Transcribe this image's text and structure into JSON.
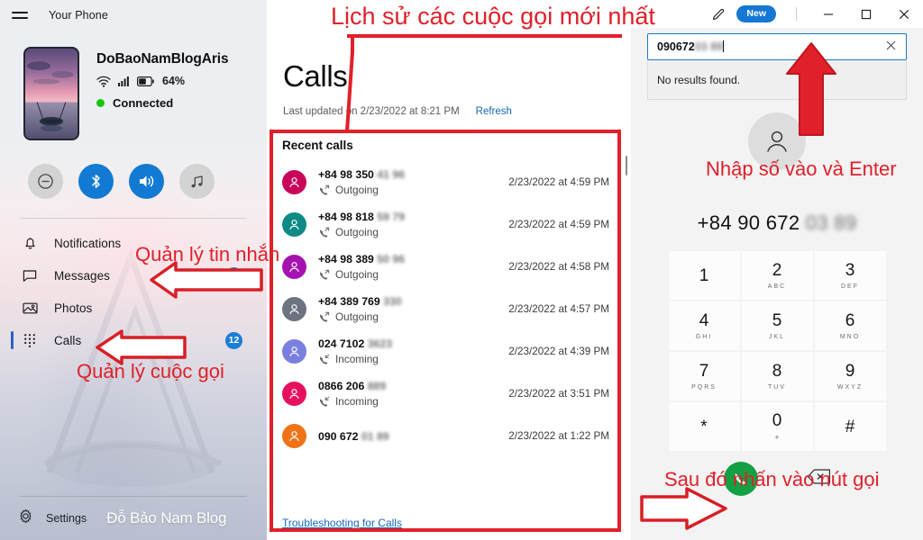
{
  "window": {
    "app_title": "Your Phone",
    "menu_icon": "hamburger-icon",
    "pen_icon": "pen-compose-icon",
    "new_badge": "New",
    "minimize": "–",
    "maximize": "□",
    "close": "✕"
  },
  "sidebar": {
    "device": {
      "name": "DoBaoNamBlogAris",
      "battery": "64%",
      "status": "Connected",
      "wifi_icon": "wifi-icon",
      "signal_icon": "cellular-signal-icon",
      "battery_icon": "battery-icon"
    },
    "quick_actions": [
      {
        "name": "do-not-disturb",
        "icon": "do-not-disturb-icon",
        "active": false
      },
      {
        "name": "bluetooth",
        "icon": "bluetooth-icon",
        "active": true
      },
      {
        "name": "volume",
        "icon": "volume-icon",
        "active": true
      },
      {
        "name": "music",
        "icon": "music-note-icon",
        "active": false
      }
    ],
    "nav_items": [
      {
        "label": "Notifications",
        "icon": "bell-icon",
        "badge": "",
        "active": false
      },
      {
        "label": "Messages",
        "icon": "message-bubble-icon",
        "badge": "30",
        "active": false
      },
      {
        "label": "Photos",
        "icon": "photo-icon",
        "badge": "",
        "active": false
      },
      {
        "label": "Calls",
        "icon": "dialpad-icon",
        "badge": "12",
        "active": true
      }
    ],
    "settings_label": "Settings",
    "settings_icon": "gear-icon",
    "watermark": "Đỗ Bảo Nam Blog"
  },
  "calls_panel": {
    "title": "Calls",
    "last_updated": "Last updated on 2/23/2022 at 8:21 PM",
    "refresh_label": "Refresh",
    "recent_header": "Recent calls",
    "troubleshoot_link": "Troubleshooting for Calls",
    "rows": [
      {
        "number_visible": "+84 98 350",
        "number_blur": "41 96",
        "direction": "Outgoing",
        "time": "2/23/2022 at 4:59 PM",
        "avatar_color": "#c9055a"
      },
      {
        "number_visible": "+84 98 818",
        "number_blur": "59 79",
        "direction": "Outgoing",
        "time": "2/23/2022 at 4:59 PM",
        "avatar_color": "#0e8a86"
      },
      {
        "number_visible": "+84 98 389",
        "number_blur": "50 96",
        "direction": "Outgoing",
        "time": "2/23/2022 at 4:58 PM",
        "avatar_color": "#a512b0"
      },
      {
        "number_visible": "+84 389 769",
        "number_blur": "330",
        "direction": "Outgoing",
        "time": "2/23/2022 at 4:57 PM",
        "avatar_color": "#6b7280"
      },
      {
        "number_visible": "024 7102",
        "number_blur": "3623",
        "direction": "Incoming",
        "time": "2/23/2022 at 4:39 PM",
        "avatar_color": "#7b7fe0"
      },
      {
        "number_visible": "0866 206",
        "number_blur": "889",
        "direction": "Incoming",
        "time": "2/23/2022 at 3:51 PM",
        "avatar_color": "#e6115e"
      },
      {
        "number_visible": "090 672",
        "number_blur": "01 89",
        "direction": "",
        "time": "2/23/2022 at 1:22 PM",
        "avatar_color": "#f07318"
      }
    ]
  },
  "dialer": {
    "search_value_visible": "090672",
    "search_value_blur": "03 89",
    "clear_icon": "clear-x-icon",
    "no_results": "No results found.",
    "avatar_icon": "person-icon",
    "number_visible": "+84 90 672",
    "number_blur": "03 89",
    "keys": [
      {
        "digit": "1",
        "letters": ""
      },
      {
        "digit": "2",
        "letters": "ABC"
      },
      {
        "digit": "3",
        "letters": "DEF"
      },
      {
        "digit": "4",
        "letters": "GHI"
      },
      {
        "digit": "5",
        "letters": "JKL"
      },
      {
        "digit": "6",
        "letters": "MNO"
      },
      {
        "digit": "7",
        "letters": "PQRS"
      },
      {
        "digit": "8",
        "letters": "TUV"
      },
      {
        "digit": "9",
        "letters": "WXYZ"
      },
      {
        "digit": "*",
        "letters": ""
      },
      {
        "digit": "0",
        "letters": "+"
      },
      {
        "digit": "#",
        "letters": ""
      }
    ],
    "call_icon": "phone-call-icon",
    "backspace_icon": "backspace-icon"
  },
  "annotations": {
    "top": "Lịch sử các cuộc gọi mới nhất",
    "messages": "Quản lý tin nhắn",
    "calls": "Quản lý cuộc gọi",
    "enter": "Nhập số vào và Enter",
    "press_call": "Sau đó nhấn vào nút gọi",
    "color": "#e0202a"
  }
}
